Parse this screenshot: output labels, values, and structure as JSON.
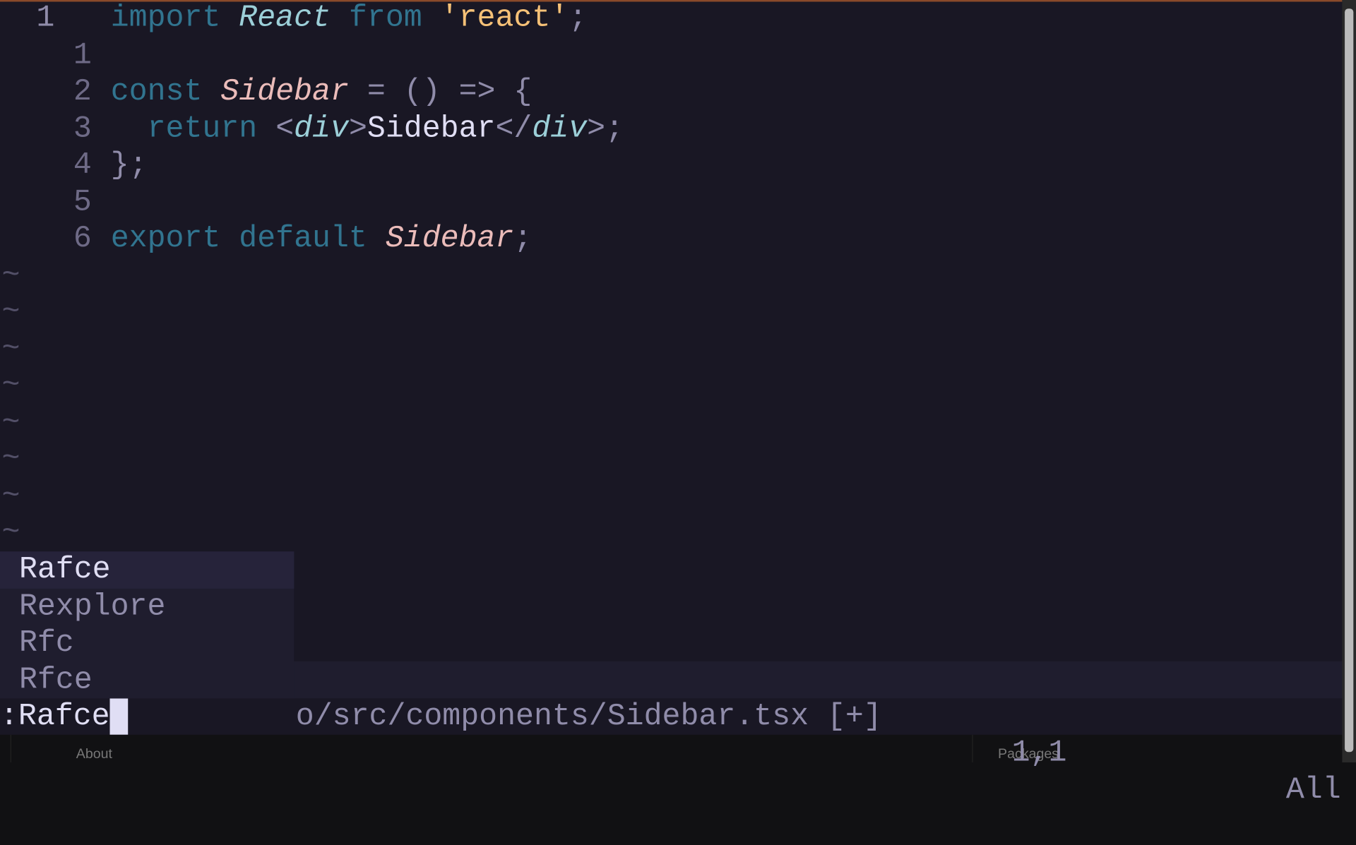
{
  "colors": {
    "background": "#191724",
    "keyword": "#31748f",
    "type": "#9ccfd8",
    "identifier": "#ebbcba",
    "string": "#f6c177",
    "text": "#e0def4",
    "line_number": "#6e6a86"
  },
  "editor": {
    "lines": [
      {
        "num": "1",
        "current": true,
        "tokens": [
          [
            "kw",
            "import"
          ],
          [
            "txt",
            " "
          ],
          [
            "foam",
            "React"
          ],
          [
            "txt",
            " "
          ],
          [
            "kw",
            "from"
          ],
          [
            "txt",
            " "
          ],
          [
            "gold",
            "'react'"
          ],
          [
            "punc",
            ";"
          ]
        ]
      },
      {
        "num": "1",
        "tokens": []
      },
      {
        "num": "2",
        "tokens": [
          [
            "kw",
            "const"
          ],
          [
            "txt",
            " "
          ],
          [
            "rose",
            "Sidebar"
          ],
          [
            "txt",
            " "
          ],
          [
            "punc",
            "= () => {"
          ]
        ]
      },
      {
        "num": "3",
        "tokens": [
          [
            "txt",
            "  "
          ],
          [
            "kw",
            "return"
          ],
          [
            "txt",
            " "
          ],
          [
            "punc",
            "<"
          ],
          [
            "foam",
            "div"
          ],
          [
            "punc",
            ">"
          ],
          [
            "txt",
            "Sidebar"
          ],
          [
            "punc",
            "</"
          ],
          [
            "foam",
            "div"
          ],
          [
            "punc",
            ">;"
          ]
        ]
      },
      {
        "num": "4",
        "tokens": [
          [
            "punc",
            "};"
          ]
        ]
      },
      {
        "num": "5",
        "tokens": []
      },
      {
        "num": "6",
        "tokens": [
          [
            "kw",
            "export"
          ],
          [
            "txt",
            " "
          ],
          [
            "kw",
            "default"
          ],
          [
            "txt",
            " "
          ],
          [
            "rose",
            "Sidebar"
          ],
          [
            "punc",
            ";"
          ]
        ]
      }
    ],
    "tilde": "~",
    "tilde_rows": 8
  },
  "popup": {
    "items": [
      "Rafce",
      "Rexplore",
      "Rfc",
      "Rfce"
    ],
    "selected": 0
  },
  "statusline": {
    "file": "o/src/components/Sidebar.tsx [+]",
    "position": "1,1",
    "scroll": "All"
  },
  "cmdline": {
    "text": ":Rafce"
  },
  "bottom": {
    "left": "About",
    "right": "Packages"
  }
}
